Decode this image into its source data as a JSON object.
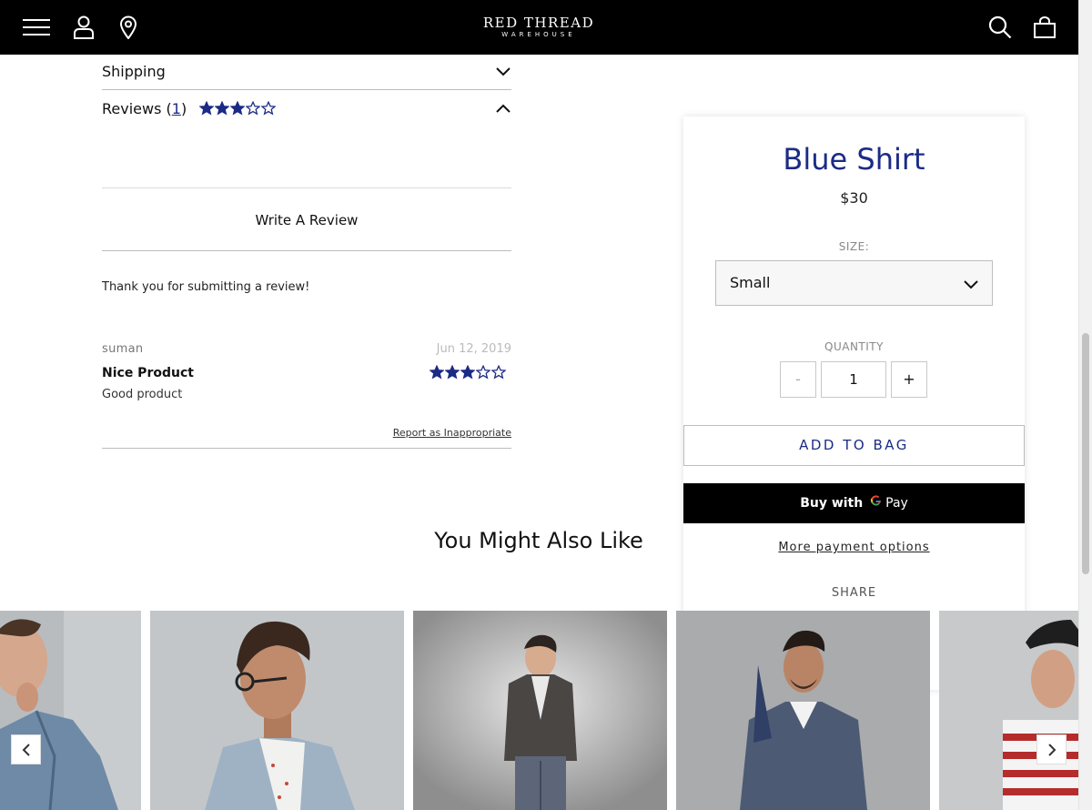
{
  "header": {
    "logo_main": "RED THREAD",
    "logo_sub": "WAREHOUSE",
    "icons": [
      "menu-icon",
      "account-icon",
      "location-icon",
      "search-icon",
      "shopping-bag-icon"
    ]
  },
  "accordion": {
    "shipping_label": "Shipping",
    "reviews_label": "Reviews",
    "reviews_count_open": "(",
    "reviews_count": "1",
    "reviews_count_close": ")",
    "average_rating": 3,
    "max_rating": 5
  },
  "reviews": {
    "write_review_label": "Write A Review",
    "thank_you_message": "Thank you for submitting a review!",
    "items": [
      {
        "author": "suman",
        "date": "Jun 12, 2019",
        "title": "Nice Product",
        "body": "Good product",
        "rating": 3,
        "report_label": "Report as Inappropriate"
      }
    ]
  },
  "related": {
    "heading": "You Might Also Like"
  },
  "product": {
    "title": "Blue Shirt",
    "price": "$30",
    "size_label": "SIZE:",
    "size_value": "Small",
    "quantity_label": "QUANTITY",
    "quantity_value": "1",
    "decrement_label": "-",
    "increment_label": "+",
    "add_to_bag_label": "ADD TO BAG",
    "gpay_buy_label": "Buy with",
    "gpay_pay_label": "Pay",
    "more_payment_label": "More payment options",
    "share_label": "SHARE"
  },
  "colors": {
    "brand_navy": "#1b2b85",
    "header_bg": "#000000",
    "star": "#1b2b85"
  }
}
